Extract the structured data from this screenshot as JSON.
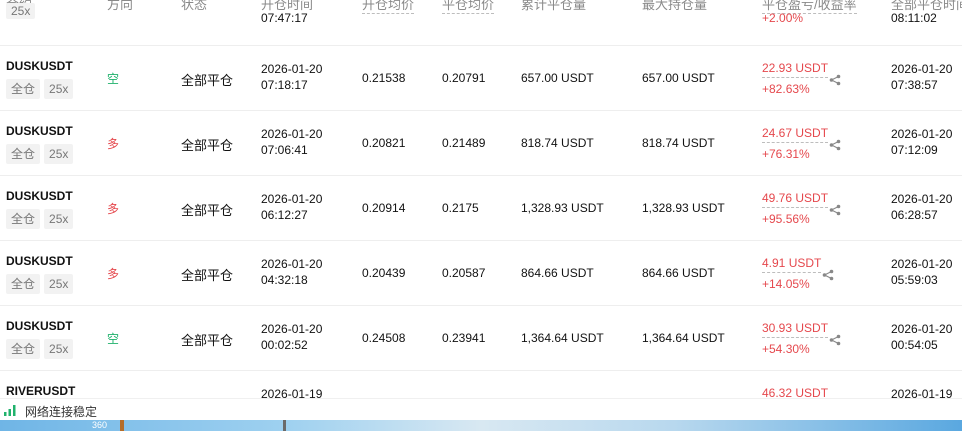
{
  "header": {
    "symbol": "合约",
    "direction": "方向",
    "status": "状态",
    "open_time": "开仓时间",
    "open_avg": "开仓均价",
    "close_avg": "平仓均价",
    "cum_close": "累计平仓量",
    "max_hold": "最大持仓量",
    "pnl": "平仓盈亏/收益率",
    "close_time": "全部平仓时间"
  },
  "partial_row": {
    "leverage": "25x",
    "open_time": "07:47:17",
    "pnl_rate": "+2.00%",
    "close_time": "08:11:02"
  },
  "rows": [
    {
      "symbol": "DUSKUSDT",
      "margin": "全仓",
      "leverage": "25x",
      "direction": "空",
      "dir_type": "short",
      "status": "全部平仓",
      "open_date": "2026-01-20",
      "open_time": "07:18:17",
      "open_avg": "0.21538",
      "close_avg": "0.20791",
      "cum_close": "657.00 USDT",
      "max_hold": "657.00 USDT",
      "pnl": "22.93 USDT",
      "rate": "+82.63%",
      "close_date": "2026-01-20",
      "close_time": "07:38:57"
    },
    {
      "symbol": "DUSKUSDT",
      "margin": "全仓",
      "leverage": "25x",
      "direction": "多",
      "dir_type": "long",
      "status": "全部平仓",
      "open_date": "2026-01-20",
      "open_time": "07:06:41",
      "open_avg": "0.20821",
      "close_avg": "0.21489",
      "cum_close": "818.74 USDT",
      "max_hold": "818.74 USDT",
      "pnl": "24.67 USDT",
      "rate": "+76.31%",
      "close_date": "2026-01-20",
      "close_time": "07:12:09"
    },
    {
      "symbol": "DUSKUSDT",
      "margin": "全仓",
      "leverage": "25x",
      "direction": "多",
      "dir_type": "long",
      "status": "全部平仓",
      "open_date": "2026-01-20",
      "open_time": "06:12:27",
      "open_avg": "0.20914",
      "close_avg": "0.2175",
      "cum_close": "1,328.93 USDT",
      "max_hold": "1,328.93 USDT",
      "pnl": "49.76 USDT",
      "rate": "+95.56%",
      "close_date": "2026-01-20",
      "close_time": "06:28:57"
    },
    {
      "symbol": "DUSKUSDT",
      "margin": "全仓",
      "leverage": "25x",
      "direction": "多",
      "dir_type": "long",
      "status": "全部平仓",
      "open_date": "2026-01-20",
      "open_time": "04:32:18",
      "open_avg": "0.20439",
      "close_avg": "0.20587",
      "cum_close": "864.66 USDT",
      "max_hold": "864.66 USDT",
      "pnl": "4.91 USDT",
      "rate": "+14.05%",
      "close_date": "2026-01-20",
      "close_time": "05:59:03"
    },
    {
      "symbol": "DUSKUSDT",
      "margin": "全仓",
      "leverage": "25x",
      "direction": "空",
      "dir_type": "short",
      "status": "全部平仓",
      "open_date": "2026-01-20",
      "open_time": "00:02:52",
      "open_avg": "0.24508",
      "close_avg": "0.23941",
      "cum_close": "1,364.64 USDT",
      "max_hold": "1,364.64 USDT",
      "pnl": "30.93 USDT",
      "rate": "+54.30%",
      "close_date": "2026-01-20",
      "close_time": "00:54:05"
    },
    {
      "symbol": "RIVERUSDT",
      "margin": "",
      "leverage": "",
      "direction": "",
      "dir_type": "long",
      "status": "",
      "open_date": "2026-01-19",
      "open_time": "",
      "open_avg": "",
      "close_avg": "",
      "cum_close": "",
      "max_hold": "",
      "pnl": "46.32 USDT",
      "rate": "",
      "close_date": "2026-01-19",
      "close_time": ""
    }
  ],
  "statusbar": {
    "network": "网络连接稳定"
  },
  "taskbar": {
    "label": "360"
  },
  "colors": {
    "profit": "#e5484d",
    "short": "#20b26c",
    "long": "#e5484d",
    "signal": "#20b26c"
  }
}
